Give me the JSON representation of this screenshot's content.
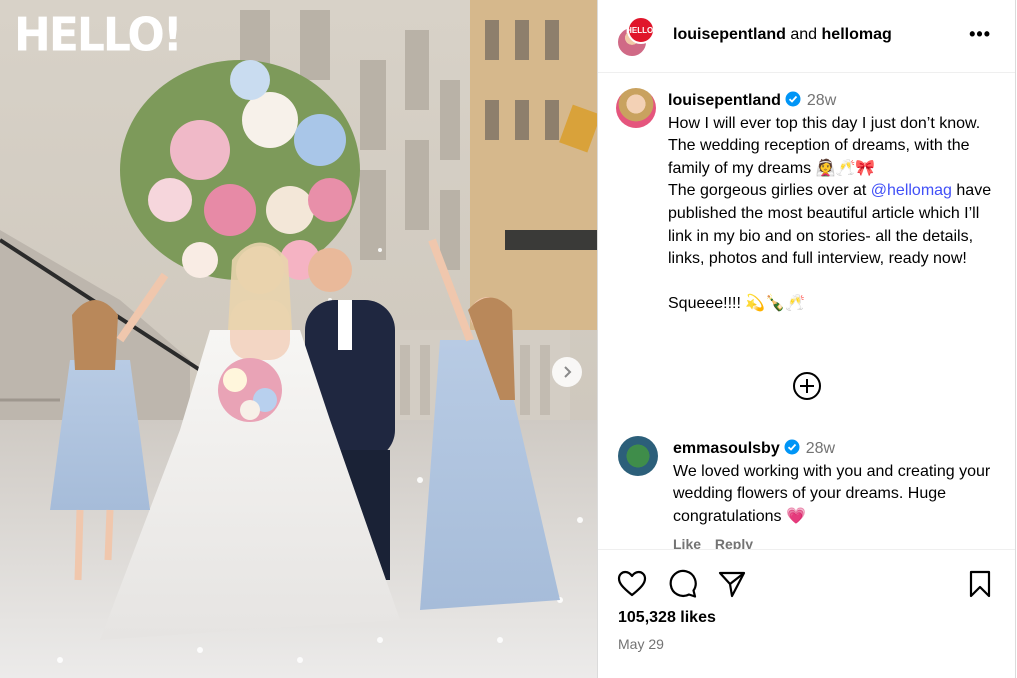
{
  "post": {
    "brand_logo_text": "HELLO!",
    "header": {
      "username_1": "louisepentland",
      "joiner": "and",
      "username_2": "hellomag",
      "more_label": "•••"
    },
    "caption": {
      "username": "louisepentland",
      "time": "28w",
      "text_1": "How I will ever top this day I just don’t know. The wedding reception of dreams, with the family of my dreams 👰🥂🎀\nThe gorgeous girlies over at ",
      "mention": "@hellomag",
      "text_2": " have published the most beautiful article which I’ll link in my bio and on stories- all the details, links, photos and full interview, ready now!\n\nSqueee!!!! 💫🍾🥂"
    },
    "comment": {
      "username": "emmasoulsby",
      "time": "28w",
      "text": "We loved working with you and creating your wedding flowers of your dreams. Huge congratulations 💗",
      "like_label": "Like",
      "reply_label": "Reply"
    },
    "likes_text": "105,328 likes",
    "date_text": "May 29"
  },
  "icons": {
    "verified": "verified-badge-icon",
    "add": "add-circle-icon",
    "like": "heart-icon",
    "comment": "comment-bubble-icon",
    "share": "paper-plane-icon",
    "save": "bookmark-icon",
    "next": "chevron-right-icon",
    "more": "more-dots-icon"
  },
  "colors": {
    "verified_blue": "#0095f6",
    "mention_blue": "#4150f7",
    "secondary_text": "#737373",
    "border": "#dbdbdb"
  }
}
